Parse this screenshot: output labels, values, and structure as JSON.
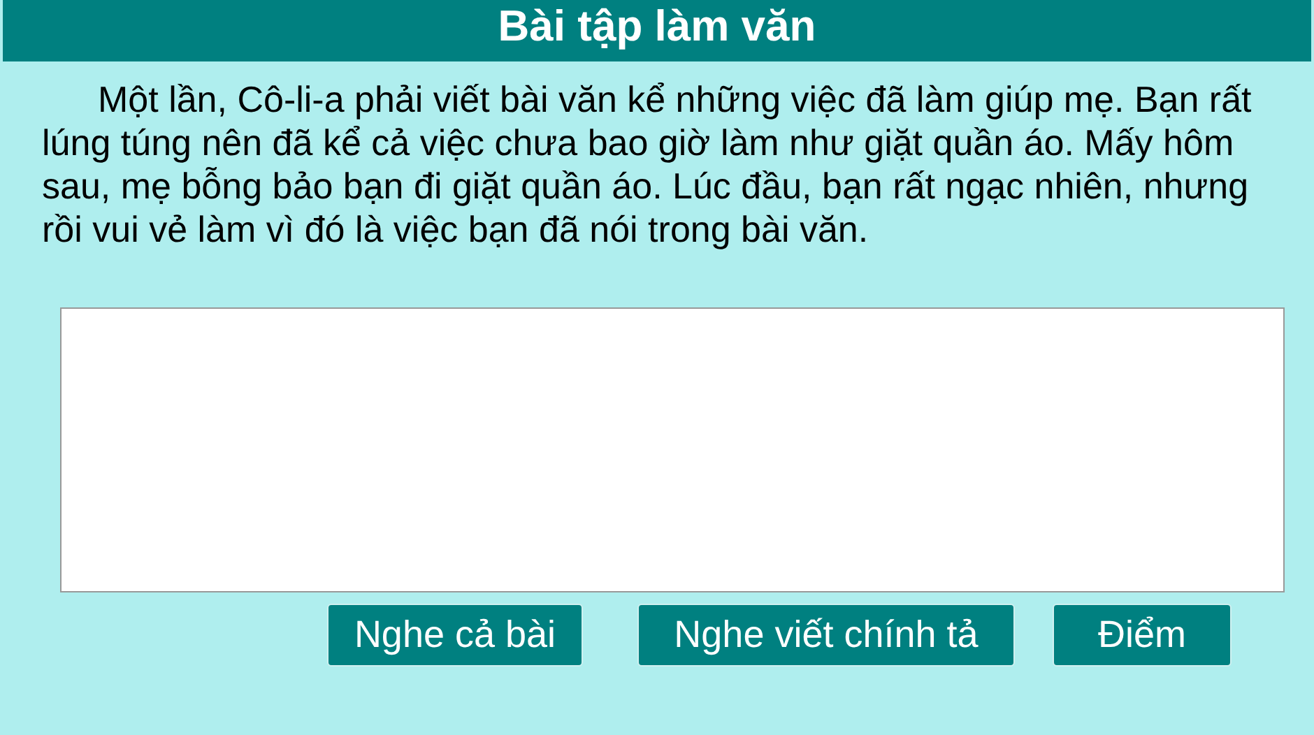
{
  "title": "Bài tập làm văn",
  "passage": "Một lần, Cô-li-a phải viết bài văn kể những việc đã làm giúp mẹ. Bạn rất lúng túng nên đã kể cả việc chưa bao giờ làm như giặt quần áo. Mấy hôm sau, mẹ bỗng bảo bạn đi giặt quần áo. Lúc đầu, bạn rất ngạc nhiên, nhưng rồi vui vẻ làm vì đó là việc bạn đã nói trong bài văn.",
  "buttons": [
    "Nghe cả bài",
    "Nghe viết chính tả",
    "Điểm"
  ]
}
